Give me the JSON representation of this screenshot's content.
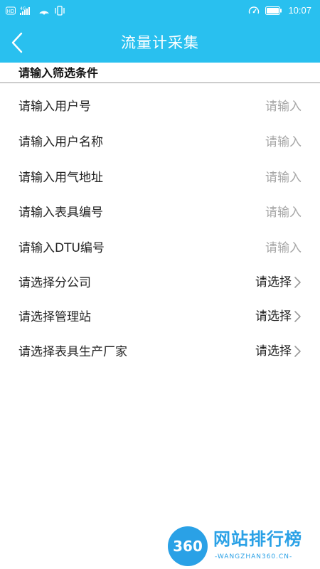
{
  "status_bar": {
    "time": "10:07",
    "icons": [
      "hd-icon",
      "signal-4g-icon",
      "hotspot-icon",
      "vibrate-icon",
      "speedometer-icon",
      "battery-icon"
    ]
  },
  "header": {
    "title": "流量计采集",
    "back_icon": "chevron-left-icon"
  },
  "filter": {
    "section_title": "请输入筛选条件",
    "input_placeholder": "请输入",
    "select_placeholder": "请选择",
    "inputs": [
      {
        "label": "请输入用户号",
        "value": ""
      },
      {
        "label": "请输入用户名称",
        "value": ""
      },
      {
        "label": "请输入用气地址",
        "value": ""
      },
      {
        "label": "请输入表具编号",
        "value": ""
      },
      {
        "label": "请输入DTU编号",
        "value": ""
      }
    ],
    "selects": [
      {
        "label": "请选择分公司",
        "value": "请选择"
      },
      {
        "label": "请选择管理站",
        "value": "请选择"
      },
      {
        "label": "请选择表具生产厂家",
        "value": "请选择"
      }
    ]
  },
  "watermark": {
    "logo_text": "360",
    "name": "网站排行榜",
    "url": "-WANGZHAN360.CN-"
  },
  "colors": {
    "accent": "#29c0ef",
    "placeholder": "#a6a6a6",
    "text": "#222222"
  }
}
